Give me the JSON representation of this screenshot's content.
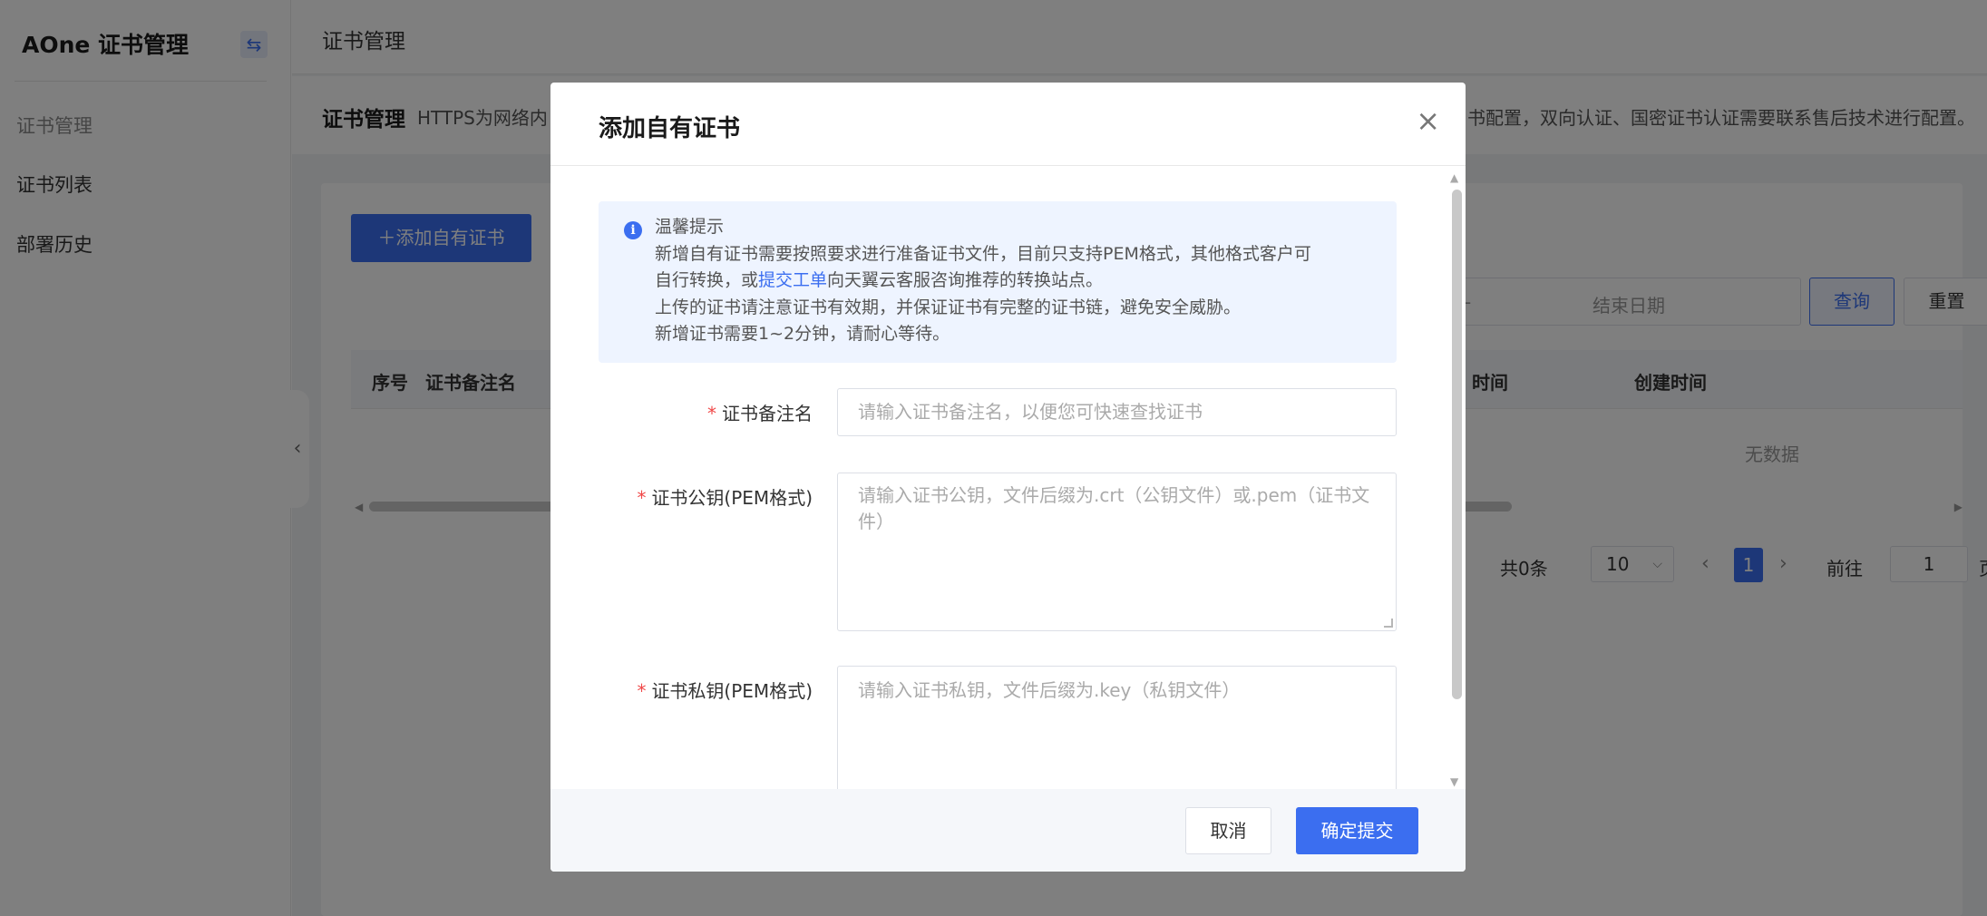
{
  "sidebar": {
    "brand": "AOne 证书管理",
    "collapse_icon": "⇆",
    "group_label": "证书管理",
    "items": [
      {
        "label": "证书列表"
      },
      {
        "label": "部署历史"
      }
    ],
    "toggle_icon": "‹"
  },
  "header": {
    "title": "证书管理"
  },
  "description": {
    "title": "证书管理",
    "text_start": "HTTPS为网络内",
    "text_end": "书配置，双向认证、国密证书认证需要联系售后技术进行配置。"
  },
  "toolbar": {
    "add_label": "＋添加自有证书",
    "date_separator": "-",
    "end_date_placeholder": "结束日期",
    "query_label": "查询",
    "reset_label": "重置"
  },
  "table": {
    "columns": [
      "序号",
      "证书备注名",
      "时间",
      "创建时间"
    ],
    "empty_text": "无数据"
  },
  "pagination": {
    "total": "共0条",
    "page_size": "10",
    "current_page": "1",
    "goto_label": "前往",
    "goto_value": "1",
    "page_suffix": "页"
  },
  "modal": {
    "title": "添加自有证书",
    "close_icon": "×",
    "tip": {
      "title": "温馨提示",
      "line1": "新增自有证书需要按照要求进行准备证书文件，目前只支持PEM格式，其他格式客户可",
      "line2_pre": "自行转换，或",
      "line2_link": "提交工单",
      "line2_post": "向天翼云客服咨询推荐的转换站点。",
      "line3": "上传的证书请注意证书有效期，并保证证书有完整的证书链，避免安全威胁。",
      "line4": "新增证书需要1~2分钟，请耐心等待。"
    },
    "form": {
      "name_label": "证书备注名",
      "name_placeholder": "请输入证书备注名，以便您可快速查找证书",
      "pubkey_label": "证书公钥(PEM格式)",
      "pubkey_placeholder": "请输入证书公钥，文件后缀为.crt（公钥文件）或.pem（证书文件）",
      "privkey_label": "证书私钥(PEM格式)",
      "privkey_placeholder": "请输入证书私钥，文件后缀为.key（私钥文件）"
    },
    "cancel_label": "取消",
    "submit_label": "确定提交"
  },
  "colors": {
    "primary": "#3b6ef0",
    "required": "#f04848",
    "overlay": "rgba(0,0,0,0.5)"
  }
}
